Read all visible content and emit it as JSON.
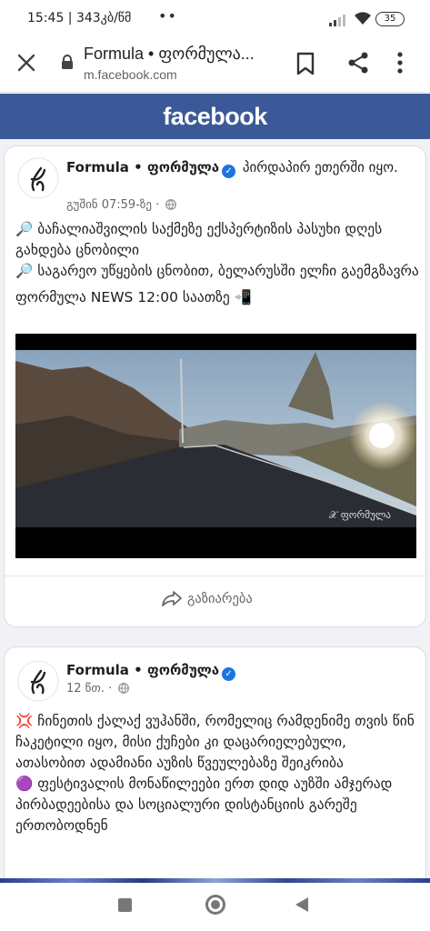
{
  "status_bar": {
    "time": "15:45 | 343კბ/წმ",
    "dots": "••",
    "battery": "35"
  },
  "browser": {
    "title": "Formula • ფორმულა...",
    "url": "m.facebook.com"
  },
  "header": {
    "logo": "facebook"
  },
  "posts": [
    {
      "page_name": "Formula • ფორმულა",
      "verified_mark": "✓",
      "activity": "პირდაპირ ეთერში იყო.",
      "timestamp": "გუშინ 07:59-ზე ·",
      "lines": [
        "🔎 ბაჩალიაშვილის საქმეზე ექსპერტიზის პასუხი დღეს გახდება ცნობილი",
        "🔎 საგარეო უწყების ცნობით, ბელარუსში ელჩი გაემგზავრა",
        "ფორმულა NEWS 12:00 საათზე 📲"
      ],
      "video_watermark": "ფორმულა",
      "share_label": "გაზიარება"
    },
    {
      "page_name": "Formula • ფორმულა",
      "verified_mark": "✓",
      "timestamp": "12 წთ. ·",
      "lines": [
        "💢 ჩინეთის ქალაქ ვუჰანში, რომელიც რამდენიმე თვის წინ ჩაკეტილი იყო, მისი ქუჩები კი დაცარიელებული, ათასობით ადამიანი აუზის წვეულებაზე შეიკრიბა",
        "🟣 ფესტივალის მონაწილეები ერთ დიდ აუზში ამჯერად პირბადეებისა და სოციალური დისტანციის გარეშე ერთობოდნენ"
      ]
    }
  ],
  "icons": {
    "close": "close-icon",
    "lock": "lock-icon",
    "bookmark": "bookmark-icon",
    "share": "share-icon",
    "more": "more-vert-icon",
    "globe": "globe-icon"
  },
  "colors": {
    "facebook_blue": "#3b5998",
    "verified_blue": "#1b74e4",
    "meta_gray": "#65676b"
  }
}
